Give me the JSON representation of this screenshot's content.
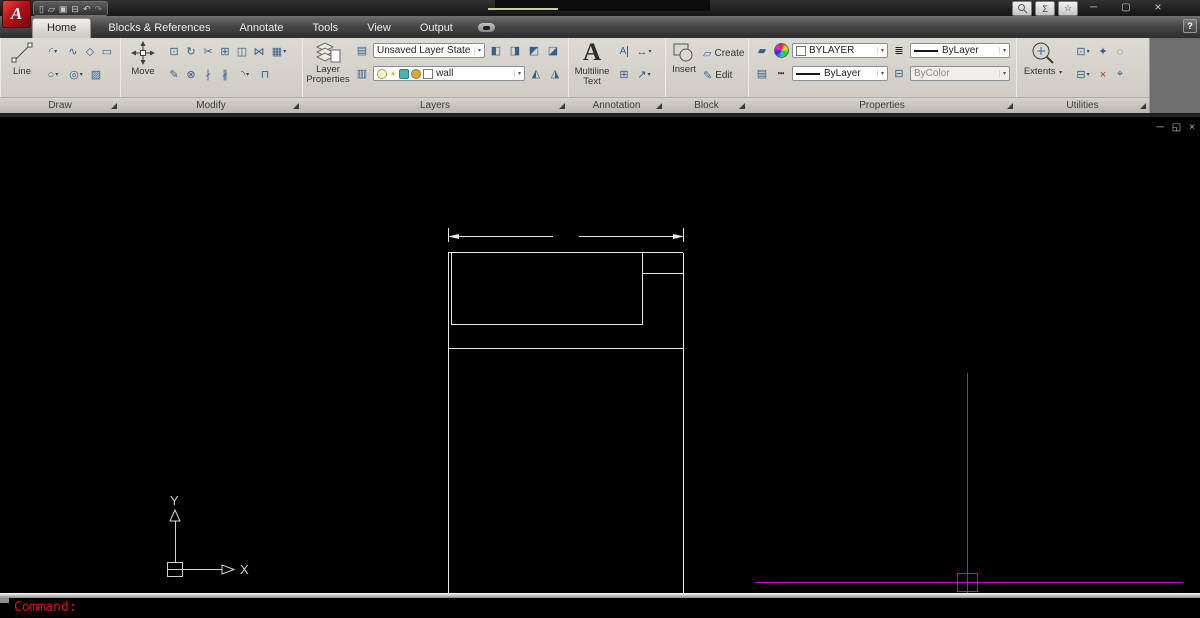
{
  "colors": {
    "crosshair": "#cf00cf",
    "drawing_line": "#e9e9e9",
    "command_text": "#e01010",
    "logo_red": "#b41118",
    "ribbon_bg": "#d6d3cc",
    "canvas_bg": "#000000"
  },
  "ui": {
    "caret": "▾",
    "combo_caret": "▾"
  },
  "title_bar": {
    "logo": "A",
    "qat": {
      "new": "▯",
      "open": "▱",
      "save": "▣",
      "plot": "⊟",
      "undo": "↶",
      "redo": "↷"
    },
    "infocenter": {
      "comm": "Σ",
      "favorites": "☆"
    },
    "window": {
      "minimize": "─",
      "maximize": "▢",
      "close": "×"
    }
  },
  "tabs": {
    "items": [
      "Home",
      "Blocks & References",
      "Annotate",
      "Tools",
      "View",
      "Output"
    ],
    "help": "?"
  },
  "ribbon": {
    "draw": {
      "title": "Draw",
      "big": "Line",
      "icons": {
        "arc": "◜",
        "polyline": "∿",
        "polygon": "◇",
        "rectangle": "▭",
        "circle": "○",
        "ellipse": "◎",
        "hatch": "▨"
      }
    },
    "modify": {
      "title": "Modify",
      "big": "Move",
      "icons": {
        "copy": "⊡",
        "rotate": "↻",
        "trim": "✂",
        "scale": "⊞",
        "stretch": "◫",
        "mirror": "⋈",
        "array": "▦",
        "erase": "✎",
        "explode": "⊗",
        "break": "∤",
        "break_at_point": "∦",
        "fillet": "◝",
        "join": "⊓"
      }
    },
    "layers": {
      "title": "Layers",
      "big": "Layer Properties",
      "state_combo": "Unsaved Layer State",
      "layer_name": "wall",
      "icons": {
        "state_manager": "▤",
        "isolate": "◧",
        "unisolate": "◨",
        "freeze": "◩",
        "lock": "◪",
        "previous": "▥",
        "match": "◭",
        "change": "◮",
        "sun": "☀"
      }
    },
    "annotation": {
      "title": "Annotation",
      "big": "Multiline Text",
      "big_glyph": "A",
      "icons": {
        "edit_text": "A",
        "dimension": "↔",
        "table": "⊞",
        "leader": "↗"
      }
    },
    "block": {
      "title": "Block",
      "big": "Insert",
      "create": "Create",
      "edit": "Edit",
      "icons": {
        "create": "▱",
        "edit": "✎"
      }
    },
    "properties": {
      "title": "Properties",
      "color_value": "BYLAYER",
      "lineweight_value": "ByLayer",
      "linetype_value": "ByLayer",
      "plotstyle_value": "ByColor",
      "icons": {
        "match_properties": "▰",
        "lineweight": "≣",
        "list": "▤",
        "linetype": "┅",
        "plot_style": "⊟"
      }
    },
    "utilities": {
      "title": "Utilities",
      "big": "Extents",
      "icons": {
        "copy": "⊡",
        "quick_select": "✦",
        "select_all": "◌",
        "paste": "⊟",
        "erase": "×",
        "measure": "⌖"
      }
    }
  },
  "canvas": {
    "controls": {
      "minimize": "─",
      "restore": "◱",
      "close": "×"
    },
    "ucs": {
      "x": "X",
      "y": "Y"
    }
  },
  "command_line": {
    "prompt": "Command:"
  }
}
